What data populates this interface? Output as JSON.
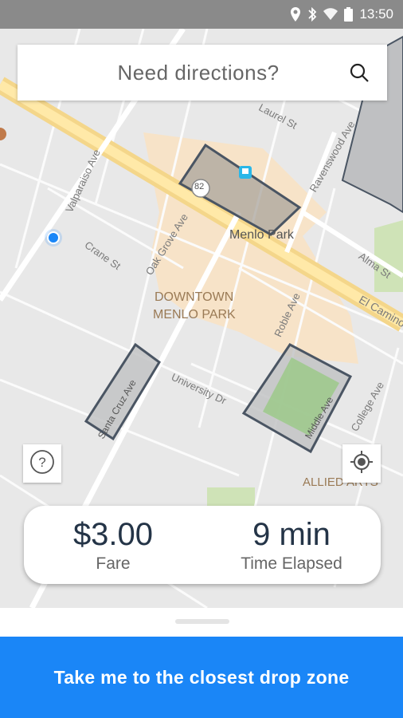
{
  "status_bar": {
    "time": "13:50",
    "icons": [
      "location-icon",
      "bluetooth-icon",
      "wifi-icon",
      "battery-icon"
    ]
  },
  "search": {
    "placeholder": "Need directions?",
    "icon": "search-icon"
  },
  "map": {
    "labels": {
      "menlo_park": "Menlo Park",
      "downtown_1": "DOWNTOWN",
      "downtown_2": "MENLO PARK",
      "allied_arts": "ALLIED ARTS",
      "valparaiso": "Valparaiso Ave",
      "crane": "Crane St",
      "oak_grove": "Oak Grove Ave",
      "laurel": "Laurel St",
      "ravenswood": "Ravenswood Ave",
      "alma": "Alma St",
      "el_camino": "El Camino",
      "roble": "Roble Ave",
      "university": "University Dr",
      "santa_cruz": "Santa Cruz Ave",
      "middle": "Middle Ave",
      "college": "College Ave",
      "route": "82"
    }
  },
  "buttons": {
    "help_icon": "help-icon",
    "locate_icon": "crosshair-icon"
  },
  "trip": {
    "fare_value": "$3.00",
    "fare_label": "Fare",
    "time_value": "9 min",
    "time_label": "Time Elapsed"
  },
  "cta": {
    "label": "Take me to the closest drop zone"
  },
  "colors": {
    "accent": "#1a86f7",
    "card_text": "#243447",
    "statusbar": "#8a8a8a",
    "zone_outline": "#4a5563"
  }
}
